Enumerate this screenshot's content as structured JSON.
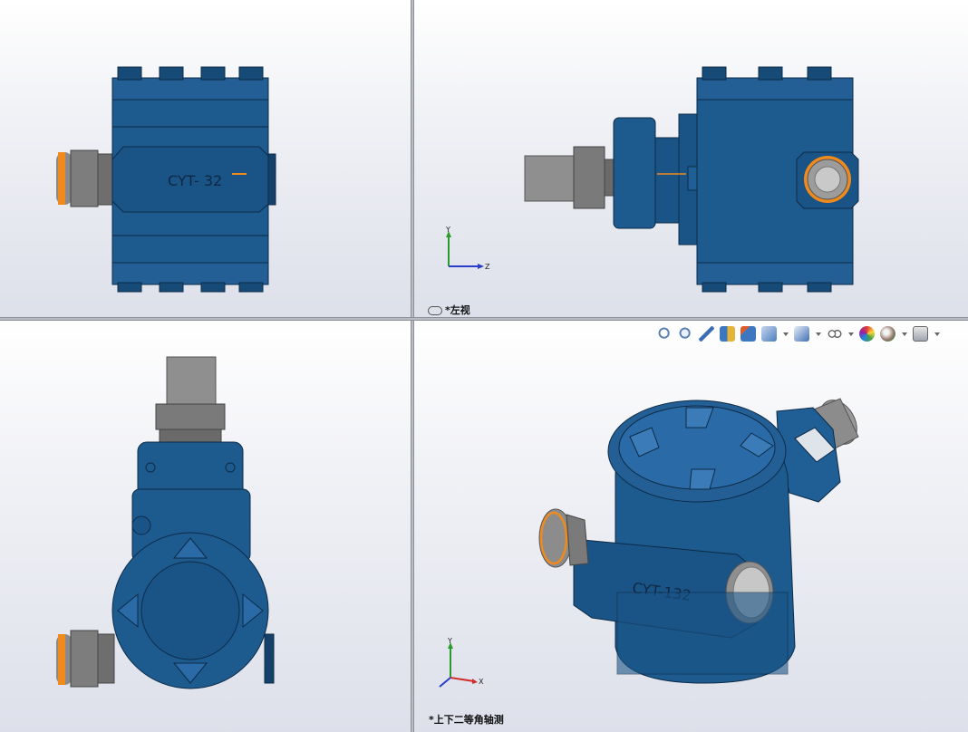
{
  "viewports": {
    "top_left": {},
    "top_right": {
      "label": "*左视"
    },
    "bottom_left": {},
    "bottom_right": {
      "label": "*上下二等角轴测",
      "toolbar": [
        {
          "icon": "zoom-to-fit-icon"
        },
        {
          "icon": "zoom-to-area-icon"
        },
        {
          "icon": "previous-view-icon"
        },
        {
          "icon": "section-view-icon"
        },
        {
          "icon": "dynamic-annotation-icon"
        },
        {
          "icon": "view-orientation-icon",
          "dropdown": true
        },
        {
          "icon": "display-style-icon",
          "dropdown": true
        },
        {
          "icon": "hide-show-items-icon",
          "dropdown": true
        },
        {
          "icon": "edit-appearance-icon"
        },
        {
          "icon": "apply-scene-icon",
          "dropdown": true
        },
        {
          "icon": "view-settings-icon",
          "dropdown": true
        }
      ]
    }
  },
  "model": {
    "engraving_front": "CYT- 32",
    "engraving_iso": "CYT-132",
    "body_color": "#1d5a8e",
    "accent_color": "#f08a1c",
    "metal_color": "#9a9a9a"
  },
  "triad": {
    "axes_left_view": [
      "Y",
      "Z"
    ],
    "axes_iso_view": [
      "Y",
      "X"
    ]
  }
}
